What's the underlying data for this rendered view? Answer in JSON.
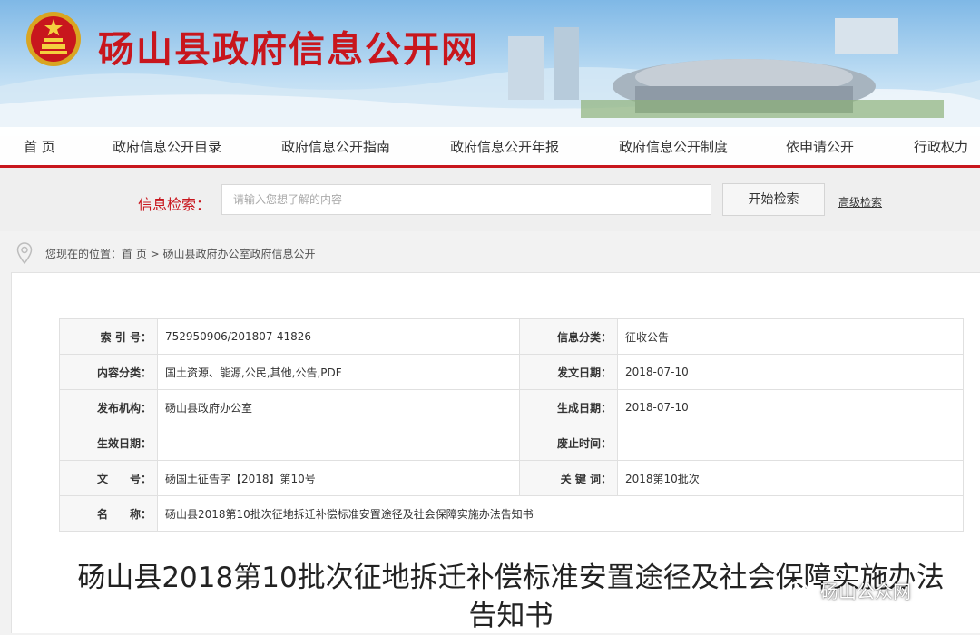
{
  "header": {
    "site_title": "砀山县政府信息公开网"
  },
  "nav": {
    "items": [
      {
        "label": "首 页"
      },
      {
        "label": "政府信息公开目录"
      },
      {
        "label": "政府信息公开指南"
      },
      {
        "label": "政府信息公开年报"
      },
      {
        "label": "政府信息公开制度"
      },
      {
        "label": "依申请公开"
      },
      {
        "label": "行政权力"
      }
    ]
  },
  "search": {
    "label": "信息检索：",
    "placeholder": "请输入您想了解的内容",
    "button_label": "开始检索",
    "advanced_label": "高级检索"
  },
  "breadcrumb": {
    "text": "您现在的位置：首 页 > 砀山县政府办公室政府信息公开"
  },
  "meta": {
    "rows": [
      {
        "l1": "索 引 号：",
        "v1": "752950906/201807-41826",
        "l2": "信息分类：",
        "v2": "征收公告"
      },
      {
        "l1": "内容分类：",
        "v1": "国土资源、能源,公民,其他,公告,PDF",
        "l2": "发文日期：",
        "v2": "2018-07-10"
      },
      {
        "l1": "发布机构：",
        "v1": "砀山县政府办公室",
        "l2": "生成日期：",
        "v2": "2018-07-10"
      },
      {
        "l1": "生效日期：",
        "v1": "",
        "l2": "废止时间：",
        "v2": ""
      },
      {
        "l1": "文　　号：",
        "v1": "砀国土征告字【2018】第10号",
        "l2": "关 键 词：",
        "v2": "2018第10批次"
      }
    ],
    "name_label": "名　　称：",
    "name_value": "砀山县2018第10批次征地拆迁补偿标准安置途径及社会保障实施办法告知书"
  },
  "document": {
    "title": "砀山县2018第10批次征地拆迁补偿标准安置途径及社会保障实施办法告知书"
  },
  "watermark": {
    "text": "砀山公众网"
  },
  "colors": {
    "accent_red": "#c8161d",
    "nav_text": "#333333"
  }
}
